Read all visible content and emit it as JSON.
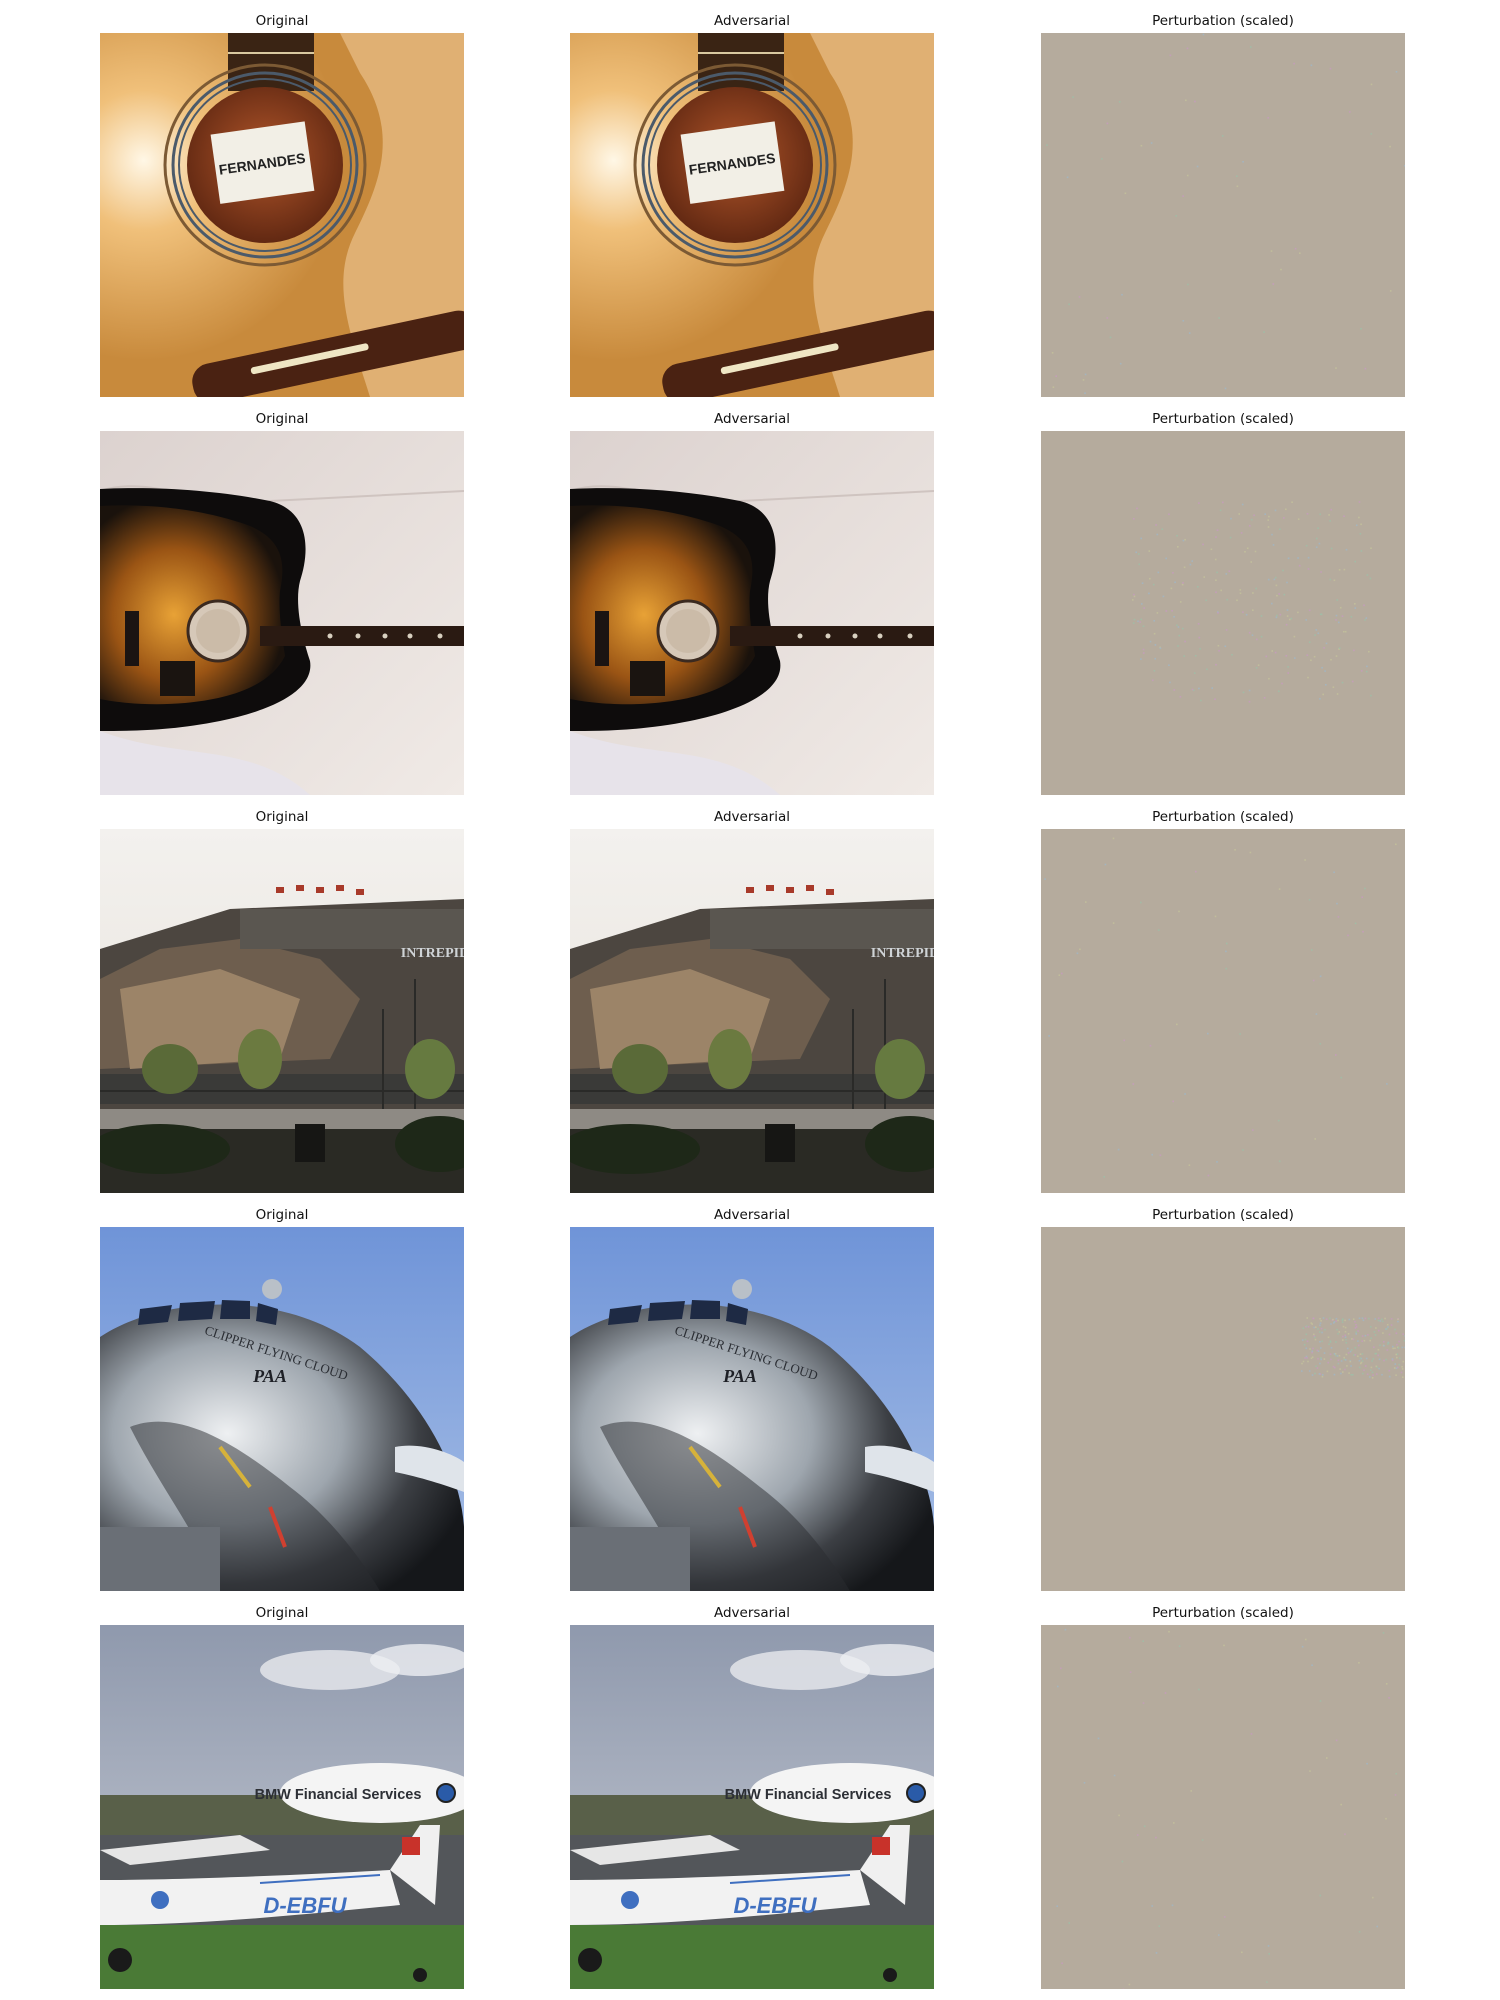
{
  "titles": {
    "original": "Original",
    "adversarial": "Adversarial",
    "perturbation": "Perturbation (scaled)"
  },
  "rows": [
    {
      "subject": "guitar-soundhole",
      "texts": [
        "FERNANDES"
      ]
    },
    {
      "subject": "sunburst-guitar",
      "texts": []
    },
    {
      "subject": "aircraft-carrier",
      "texts": [
        "INTREPID"
      ]
    },
    {
      "subject": "chrome-airliner",
      "texts": [
        "CLIPPER FLYING CLOUD",
        "PAA"
      ]
    },
    {
      "subject": "blimp-and-plane",
      "texts": [
        "BMW Financial Services",
        "D-EBFU"
      ]
    }
  ],
  "colors": {
    "perturbation_gray": "#b5ab9d"
  }
}
